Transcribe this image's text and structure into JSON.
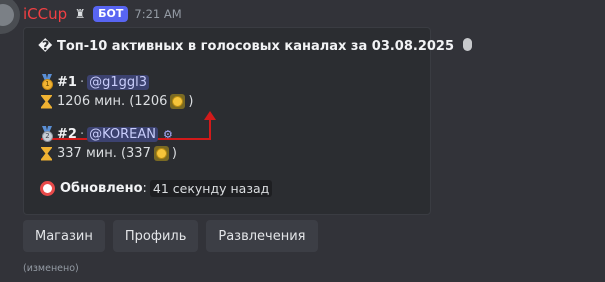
{
  "message": {
    "author": "iCCup",
    "bot_badge": "БОТ",
    "timestamp": "7:21 AM",
    "edited_label": "(изменено)"
  },
  "embed": {
    "title": "� Топ-10 активных в голосовых каналах за 03.08.2025",
    "entries": [
      {
        "rank": "#1",
        "separator": "·",
        "user_mention": "@g1ggl3",
        "minutes_text": "1206 мин. (1206",
        "close_paren": ")"
      },
      {
        "rank": "#2",
        "separator": "·",
        "user_mention": "@KOREAN",
        "minutes_text": "337 мин. (337",
        "close_paren": ")"
      }
    ],
    "updated_label": "Обновлено",
    "updated_colon": ":",
    "updated_value": "41 секунду назад"
  },
  "buttons": [
    "Магазин",
    "Профиль",
    "Развлечения"
  ],
  "colors": {
    "background": "#323339",
    "embed_background": "#2b2d31",
    "author_name": "#f23f43",
    "bot_badge": "#5865f2",
    "annotation": "#d21a1a"
  },
  "icons": {
    "title_end": "microphone-icon",
    "medal_first": "gold-medal-icon",
    "medal_second": "silver-medal-icon",
    "time": "hourglass-icon",
    "currency": "coin-icon",
    "updated": "alarm-clock-icon"
  }
}
